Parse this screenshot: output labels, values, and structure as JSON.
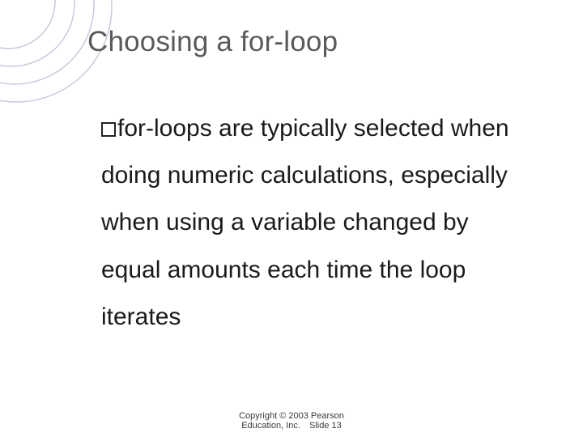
{
  "title": "Choosing a for-loop",
  "body": {
    "lead": "for-loops",
    "rest": " are typically selected when doing numeric calculations, especially when using a variable changed by equal amounts each time the loop iterates"
  },
  "footer": {
    "copyright_line1": "Copyright © 2003 Pearson",
    "copyright_line2": "Education, Inc.",
    "slide_label": "Slide 13"
  }
}
